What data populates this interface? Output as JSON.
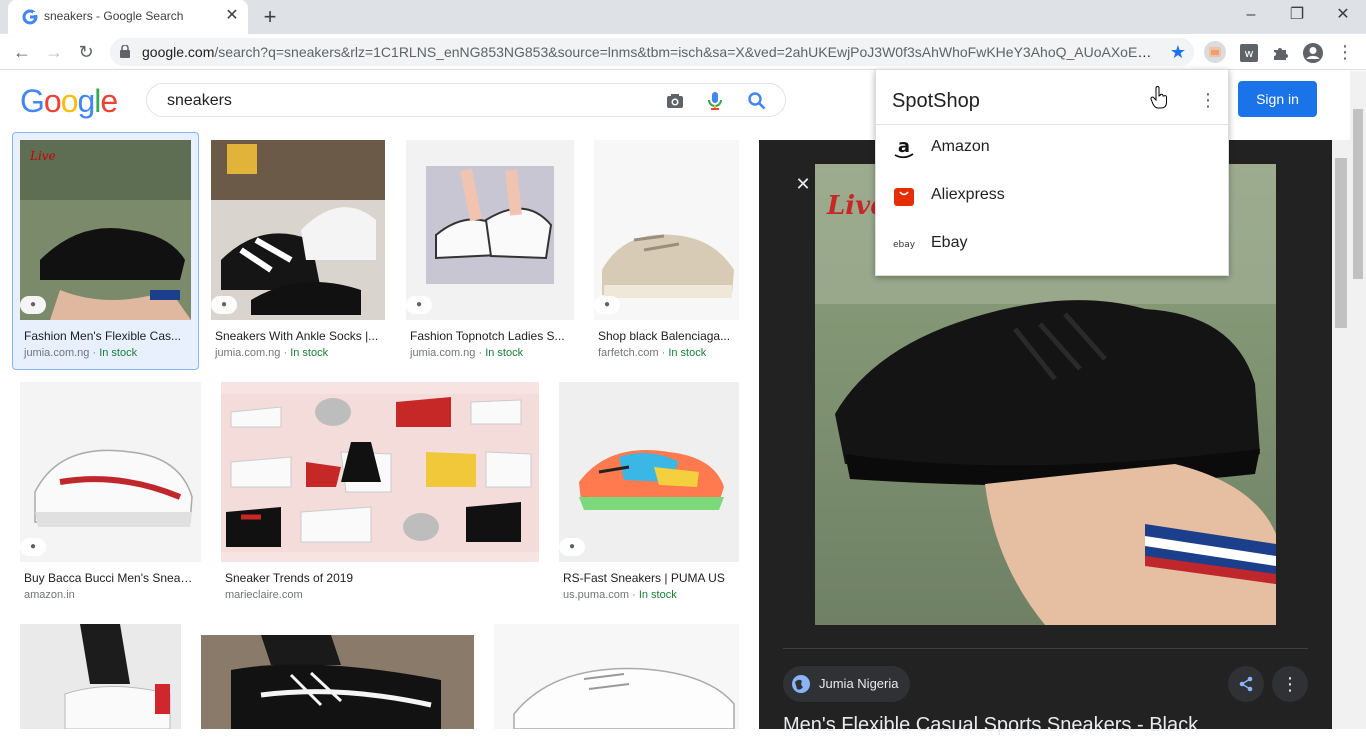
{
  "browser": {
    "tab_title": "sneakers - Google Search",
    "url_host": "google.com",
    "url_path": "/search?q=sneakers&rlz=1C1RLNS_enNG853NG853&source=lnms&tbm=isch&sa=X&ved=2ahUKEwjPoJ3W0f3sAhWhoFwKHeY3AhoQ_AUoAXoECBc...",
    "window_controls": [
      "minimize",
      "restore",
      "close"
    ]
  },
  "google": {
    "logo_letters": [
      "G",
      "o",
      "o",
      "g",
      "l",
      "e"
    ],
    "logo_colors": [
      "#4285f4",
      "#ea4335",
      "#fbbc05",
      "#4285f4",
      "#34a853",
      "#ea4335"
    ],
    "query": "sneakers",
    "signin_label": "Sign in"
  },
  "results": [
    {
      "title": "Fashion Men's Flexible Cas...",
      "source": "jumia.com.ng",
      "stock": "In stock"
    },
    {
      "title": "Sneakers With Ankle Socks |...",
      "source": "jumia.com.ng",
      "stock": "In stock"
    },
    {
      "title": "Fashion Topnotch Ladies S...",
      "source": "jumia.com.ng",
      "stock": "In stock"
    },
    {
      "title": "Shop black Balenciaga...",
      "source": "farfetch.com",
      "stock": "In stock"
    },
    {
      "title": "Buy Bacca Bucci Men's Sneak...",
      "source": "amazon.in",
      "stock": ""
    },
    {
      "title": "Sneaker Trends of 2019",
      "source": "marieclaire.com",
      "stock": ""
    },
    {
      "title": "RS-Fast Sneakers | PUMA US",
      "source": "us.puma.com",
      "stock": "In stock"
    }
  ],
  "preview": {
    "source_label": "Jumia Nigeria",
    "title": "Men's Flexible Casual Sports Sneakers - Black"
  },
  "spotshop": {
    "title": "SpotShop",
    "items": [
      {
        "label": "Amazon",
        "icon": "amazon-icon"
      },
      {
        "label": "Aliexpress",
        "icon": "aliexpress-icon"
      },
      {
        "label": "Ebay",
        "icon": "ebay-icon"
      }
    ]
  },
  "colors": {
    "accent": "#1a73e8",
    "in_stock": "#188038",
    "preview_bg": "#222222"
  }
}
